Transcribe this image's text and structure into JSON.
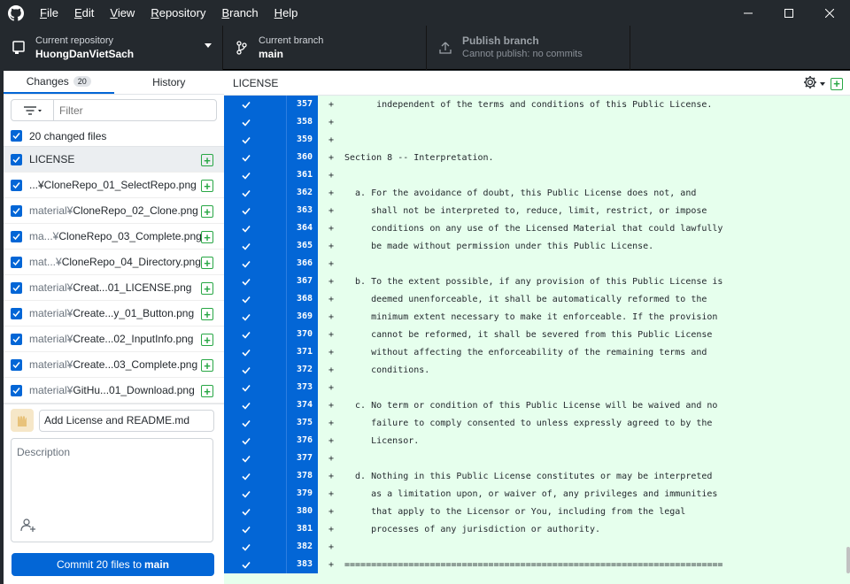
{
  "menu": {
    "items": [
      "File",
      "Edit",
      "View",
      "Repository",
      "Branch",
      "Help"
    ]
  },
  "toolbar": {
    "repo_label": "Current repository",
    "repo_value": "HuongDanVietSach",
    "branch_label": "Current branch",
    "branch_value": "main",
    "publish_label": "Publish branch",
    "publish_value": "Cannot publish: no commits"
  },
  "sidebar": {
    "tab_changes": "Changes",
    "changes_count": "20",
    "tab_history": "History",
    "filter_placeholder": "Filter",
    "changed_files_label": "20 changed files",
    "files": [
      {
        "dim": "",
        "name": "LICENSE"
      },
      {
        "dim": "",
        "name": "...¥CloneRepo_01_SelectRepo.png"
      },
      {
        "dim": "material¥",
        "name": "CloneRepo_02_Clone.png"
      },
      {
        "dim": "ma...¥",
        "name": "CloneRepo_03_Complete.png"
      },
      {
        "dim": "mat...¥",
        "name": "CloneRepo_04_Directory.png"
      },
      {
        "dim": "material¥",
        "name": "Creat...01_LICENSE.png"
      },
      {
        "dim": "material¥",
        "name": "Create...y_01_Button.png"
      },
      {
        "dim": "material¥",
        "name": "Create...02_InputInfo.png"
      },
      {
        "dim": "material¥",
        "name": "Create...03_Complete.png"
      },
      {
        "dim": "material¥",
        "name": "GitHu...01_Download.png"
      }
    ]
  },
  "commit": {
    "summary_value": "Add License and README.md",
    "description_placeholder": "Description",
    "button_prefix": "Commit 20 files to",
    "button_branch": "main"
  },
  "diff": {
    "file_title": "LICENSE",
    "lines": [
      {
        "num": "357",
        "marker": "+",
        "code": "      independent of the terms and conditions of this Public License."
      },
      {
        "num": "358",
        "marker": "+",
        "code": ""
      },
      {
        "num": "359",
        "marker": "+",
        "code": ""
      },
      {
        "num": "360",
        "marker": "+",
        "code": "Section 8 -- Interpretation."
      },
      {
        "num": "361",
        "marker": "+",
        "code": ""
      },
      {
        "num": "362",
        "marker": "+",
        "code": "  a. For the avoidance of doubt, this Public License does not, and"
      },
      {
        "num": "363",
        "marker": "+",
        "code": "     shall not be interpreted to, reduce, limit, restrict, or impose"
      },
      {
        "num": "364",
        "marker": "+",
        "code": "     conditions on any use of the Licensed Material that could lawfully"
      },
      {
        "num": "365",
        "marker": "+",
        "code": "     be made without permission under this Public License."
      },
      {
        "num": "366",
        "marker": "+",
        "code": ""
      },
      {
        "num": "367",
        "marker": "+",
        "code": "  b. To the extent possible, if any provision of this Public License is"
      },
      {
        "num": "368",
        "marker": "+",
        "code": "     deemed unenforceable, it shall be automatically reformed to the"
      },
      {
        "num": "369",
        "marker": "+",
        "code": "     minimum extent necessary to make it enforceable. If the provision"
      },
      {
        "num": "370",
        "marker": "+",
        "code": "     cannot be reformed, it shall be severed from this Public License"
      },
      {
        "num": "371",
        "marker": "+",
        "code": "     without affecting the enforceability of the remaining terms and"
      },
      {
        "num": "372",
        "marker": "+",
        "code": "     conditions."
      },
      {
        "num": "373",
        "marker": "+",
        "code": ""
      },
      {
        "num": "374",
        "marker": "+",
        "code": "  c. No term or condition of this Public License will be waived and no"
      },
      {
        "num": "375",
        "marker": "+",
        "code": "     failure to comply consented to unless expressly agreed to by the"
      },
      {
        "num": "376",
        "marker": "+",
        "code": "     Licensor."
      },
      {
        "num": "377",
        "marker": "+",
        "code": ""
      },
      {
        "num": "378",
        "marker": "+",
        "code": "  d. Nothing in this Public License constitutes or may be interpreted"
      },
      {
        "num": "379",
        "marker": "+",
        "code": "     as a limitation upon, or waiver of, any privileges and immunities"
      },
      {
        "num": "380",
        "marker": "+",
        "code": "     that apply to the Licensor or You, including from the legal"
      },
      {
        "num": "381",
        "marker": "+",
        "code": "     processes of any jurisdiction or authority."
      },
      {
        "num": "382",
        "marker": "+",
        "code": ""
      },
      {
        "num": "383",
        "marker": "+",
        "code": "======================================================================="
      }
    ]
  }
}
